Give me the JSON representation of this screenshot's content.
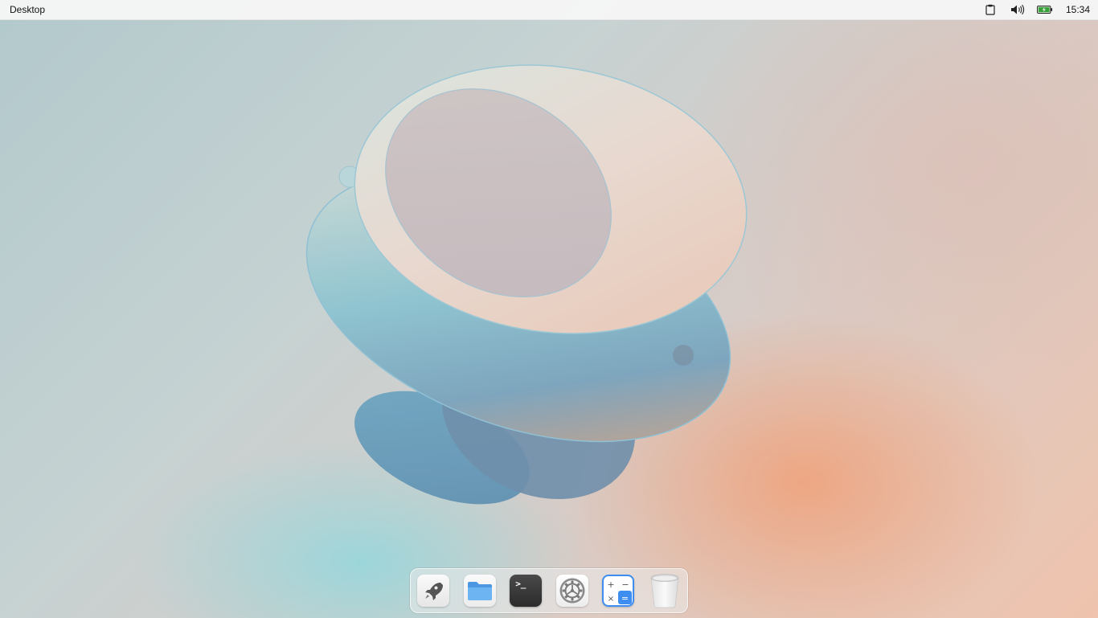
{
  "topbar": {
    "title": "Desktop",
    "clock": "15:34",
    "tray": [
      {
        "icon": "clipboard-icon"
      },
      {
        "icon": "volume-icon"
      },
      {
        "icon": "battery-charging-icon"
      }
    ]
  },
  "dock": {
    "items": [
      {
        "name": "launcher",
        "icon": "rocket-icon"
      },
      {
        "name": "files",
        "icon": "folder-icon"
      },
      {
        "name": "terminal",
        "icon": "terminal-icon",
        "glyph": ">_"
      },
      {
        "name": "settings",
        "icon": "gear-icon"
      },
      {
        "name": "calculator",
        "icon": "calculator-icon"
      },
      {
        "name": "trash",
        "icon": "trash-icon"
      }
    ]
  },
  "colors": {
    "accent": "#3d8ef0",
    "folder": "#5aa8ee",
    "panel": "#f6f6f6"
  }
}
